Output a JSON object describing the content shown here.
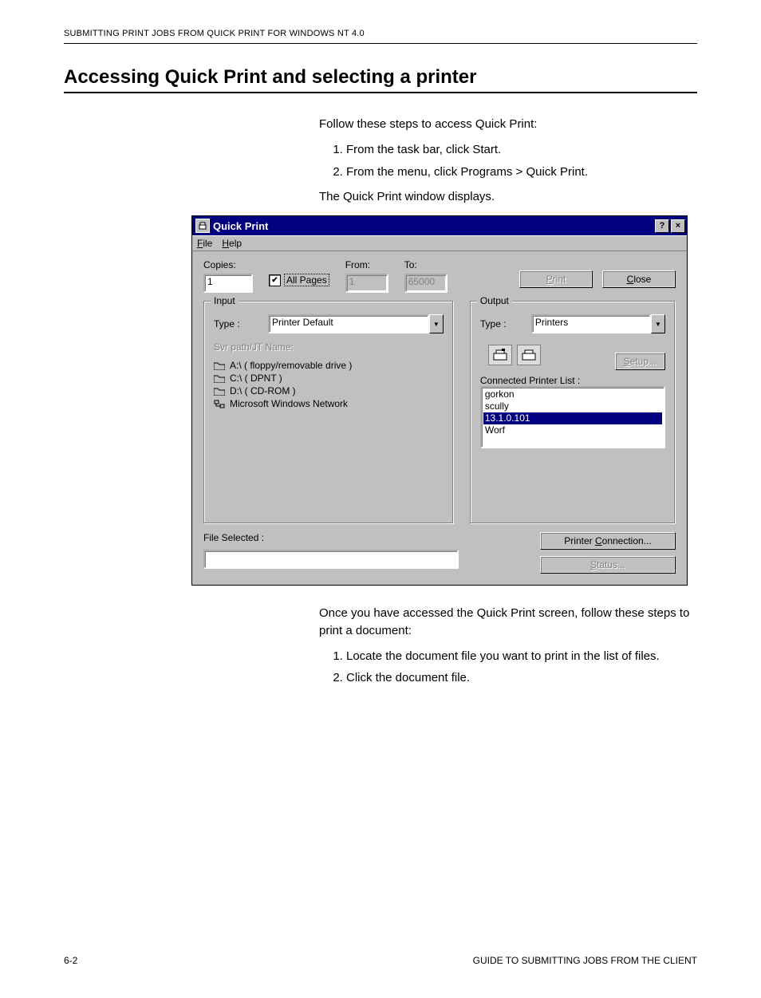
{
  "running_header": "SUBMITTING PRINT JOBS FROM QUICK PRINT FOR WINDOWS NT 4.0",
  "section_title": "Accessing Quick Print and selecting a printer",
  "intro1": "Follow these steps to access Quick Print:",
  "steps1": [
    "From the task bar, click Start.",
    "From the menu, click Programs > Quick Print."
  ],
  "after_steps1": "The Quick Print window displays.",
  "window": {
    "title": "Quick Print",
    "help_btn": "?",
    "close_btn": "×",
    "menu": {
      "file": "File",
      "help": "Help",
      "file_u": "F",
      "help_u": "H"
    },
    "copies_label": "Copies:",
    "copies_value": "1",
    "all_pages_label": "All Pages",
    "from_label": "From:",
    "from_value": "1",
    "to_label": "To:",
    "to_value": "65000",
    "print_btn": "Print",
    "print_u": "P",
    "close_btn_label": "Close",
    "close_u": "C",
    "input": {
      "legend": "Input",
      "type_label": "Type :",
      "type_value": "Printer Default",
      "svr_label": "Svr path/JT Name:",
      "tree": [
        "A:\\ ( floppy/removable drive )",
        "C:\\ ( DPNT )",
        "D:\\ ( CD-ROM )",
        "Microsoft Windows Network"
      ]
    },
    "output": {
      "legend": "Output",
      "type_label": "Type :",
      "type_value": "Printers",
      "setup_btn": "Setup...",
      "setup_u": "S",
      "connected_label": "Connected Printer List :",
      "printers": [
        "gorkon",
        "scully",
        "13.1.0.101",
        "Worf"
      ],
      "selected_index": 2
    },
    "file_selected_label": "File Selected :",
    "file_selected_value": "",
    "printer_connection_btn": "Printer Connection...",
    "printer_connection_u": "C",
    "status_btn": "Status...",
    "status_u": "S"
  },
  "intro2": "Once you have accessed the Quick Print screen, follow these steps to print a document:",
  "steps2": [
    "Locate the document file you want to print in the list of files.",
    "Click the document file."
  ],
  "footer_left": "6-2",
  "footer_right": "GUIDE TO SUBMITTING JOBS FROM THE CLIENT"
}
